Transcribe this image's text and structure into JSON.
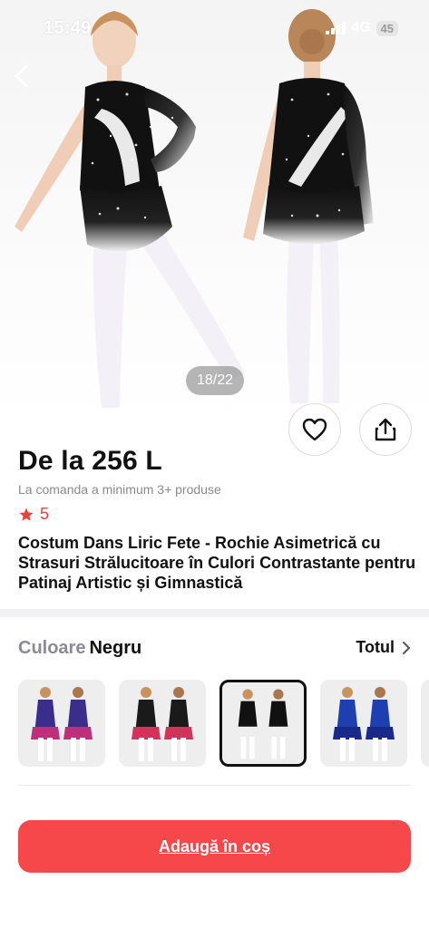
{
  "status_bar": {
    "time": "15:49",
    "network": "4G",
    "battery": "45"
  },
  "gallery": {
    "counter": "18/22",
    "icons": {
      "back": "chevron-left-icon",
      "favorite": "heart-icon",
      "share": "share-icon"
    }
  },
  "product": {
    "price": "De la 256 L",
    "min_order": "La comanda a minimum 3+ produse",
    "rating": "5",
    "title": "Costum Dans Liric Fete - Rochie Asimetrică cu Strasuri Strălucitoare în Culori Contrastante pentru Patinaj Artistic și Gimnastică"
  },
  "color_selector": {
    "label": "Culoare",
    "selected": "Negru",
    "all_link": "Totul",
    "options": [
      {
        "colors": [
          "#3a2d8c",
          "#c0307a"
        ]
      },
      {
        "colors": [
          "#1a1a1a",
          "#d0345a"
        ]
      },
      {
        "colors": [
          "#111111",
          "#ffffff"
        ],
        "selected": true
      },
      {
        "colors": [
          "#1e3fb0",
          "#1a2a8a"
        ]
      }
    ]
  },
  "actions": {
    "add_to_cart": "Adaugă în coș"
  },
  "colors": {
    "accent": "#f6474a",
    "rating_star": "#e8423f"
  }
}
